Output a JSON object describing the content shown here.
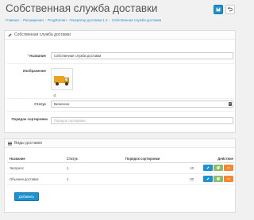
{
  "header": {
    "title": "Собственная служба доставки",
    "save_icon": "save-icon",
    "back_icon": "back-arrow-icon"
  },
  "breadcrumb": [
    "Главная",
    "Расширения",
    "ProgRoman - Генератор доставки 1.2",
    "Собственная служба доставки"
  ],
  "form_panel": {
    "heading": "Собственная служба доставки",
    "name_label": "Название",
    "name_value": "Собственная служба доставки",
    "image_label": "Изображение",
    "status_label": "Статус",
    "status_value": "Включено",
    "sort_label": "Порядок сортировки",
    "sort_placeholder": "Порядок сортировки"
  },
  "types_panel": {
    "heading": "Виды доставки",
    "columns": {
      "name": "Название",
      "status": "Статус",
      "sort": "Порядок сортировки",
      "action": "Действие"
    },
    "rows": [
      {
        "name": "Экспресс",
        "status": "1",
        "sort": "10"
      },
      {
        "name": "Обычная доставка",
        "status": "1",
        "sort": "20"
      }
    ],
    "add_label": "Добавить"
  },
  "colors": {
    "primary": "#1e91cf",
    "success": "#8fbb6c",
    "warning": "#f38733"
  }
}
